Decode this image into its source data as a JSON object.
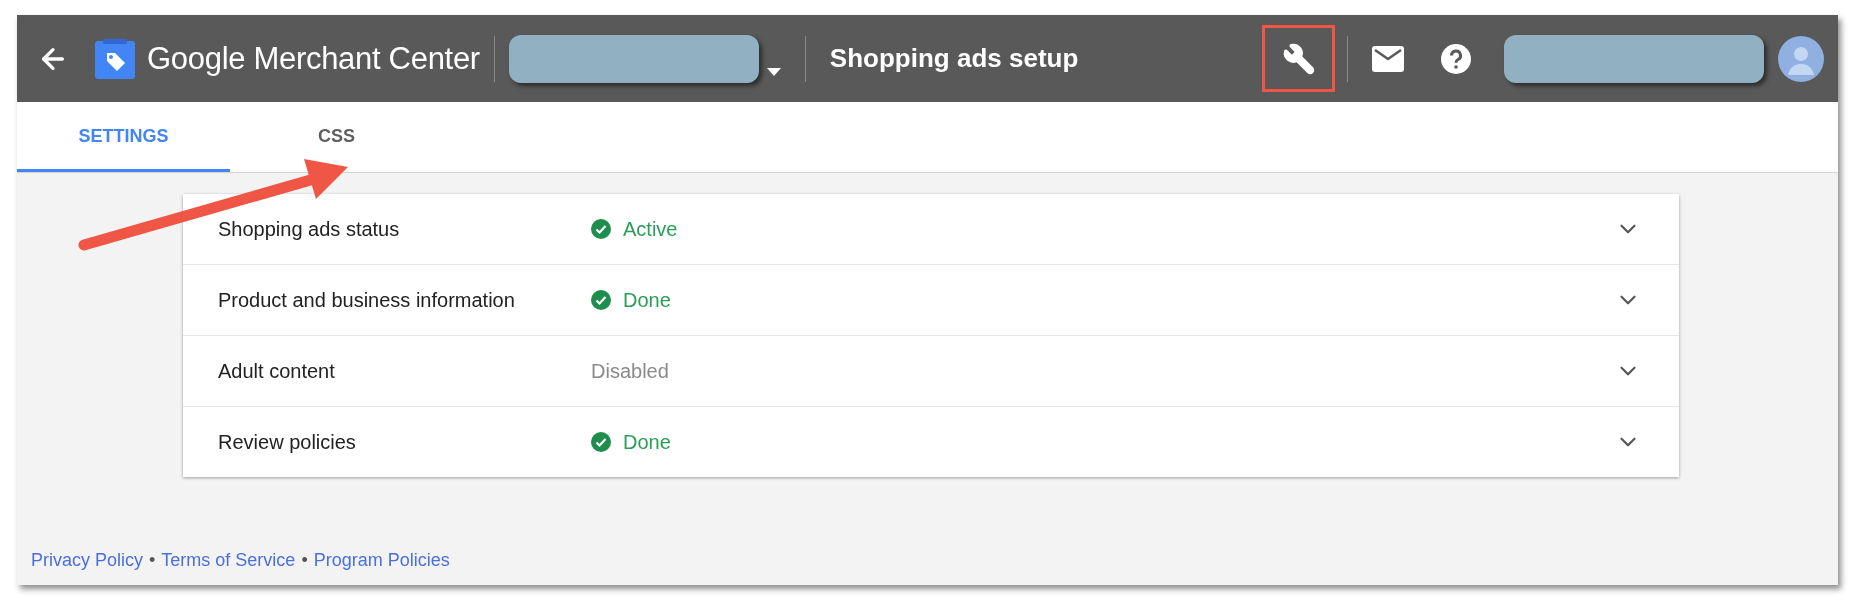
{
  "header": {
    "back": true,
    "product_name": "Google Merchant Center",
    "page_title": "Shopping ads setup",
    "tools": [
      {
        "kind": "wrench",
        "highlighted": true
      },
      {
        "kind": "mail",
        "highlighted": false
      },
      {
        "kind": "help",
        "highlighted": false
      }
    ]
  },
  "tabs": [
    {
      "label": "SETTINGS",
      "selected": true
    },
    {
      "label": "CSS",
      "selected": false
    }
  ],
  "settings": [
    {
      "label": "Shopping ads status",
      "status": "Active",
      "kind": "done",
      "expanded": false
    },
    {
      "label": "Product and business information",
      "status": "Done",
      "kind": "done",
      "expanded": false
    },
    {
      "label": "Adult content",
      "status": "Disabled",
      "kind": "plain",
      "expanded": false
    },
    {
      "label": "Review policies",
      "status": "Done",
      "kind": "done",
      "expanded": false
    }
  ],
  "footer_links": [
    "Privacy Policy",
    "Terms of Service",
    "Program Policies"
  ],
  "footer_separator": "•",
  "annotations": [
    {
      "kind": "arrow"
    }
  ]
}
